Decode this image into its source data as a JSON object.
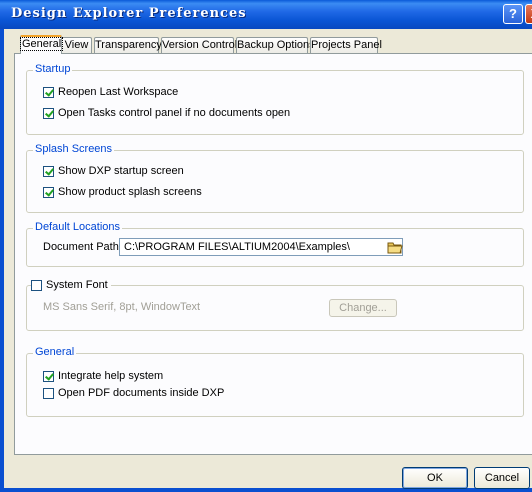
{
  "window": {
    "title": "Design Explorer Preferences",
    "help_label": "?",
    "close_label": "X"
  },
  "tabs": [
    {
      "label": "General",
      "active": true
    },
    {
      "label": "View"
    },
    {
      "label": "Transparency"
    },
    {
      "label": "Version Control"
    },
    {
      "label": "Backup Options"
    },
    {
      "label": "Projects Panel"
    }
  ],
  "startup": {
    "title": "Startup",
    "reopen_last_workspace": {
      "label": "Reopen Last Workspace",
      "checked": true
    },
    "open_tasks_panel": {
      "label": "Open Tasks control panel if no documents open",
      "checked": true
    }
  },
  "splash": {
    "title": "Splash Screens",
    "show_dxp_startup": {
      "label": "Show DXP startup screen",
      "checked": true
    },
    "show_product_splash": {
      "label": "Show product splash screens",
      "checked": true
    }
  },
  "locations": {
    "title": "Default Locations",
    "document_path_label": "Document Path",
    "document_path_value": "C:\\PROGRAM FILES\\ALTIUM2004\\Examples\\"
  },
  "system_font": {
    "label": "System Font",
    "checked": false,
    "font_desc": "MS Sans Serif, 8pt, WindowText",
    "change_label": "Change..."
  },
  "general": {
    "title": "General",
    "integrate_help": {
      "label": "Integrate help system",
      "checked": true
    },
    "open_pdf_inside": {
      "label": "Open PDF documents inside DXP",
      "checked": false
    }
  },
  "buttons": {
    "ok_label": "OK",
    "cancel_label": "Cancel"
  },
  "colors": {
    "title_bar": "#0a5ad8",
    "group_label": "#0046d5",
    "check_mark": "#21a121"
  }
}
